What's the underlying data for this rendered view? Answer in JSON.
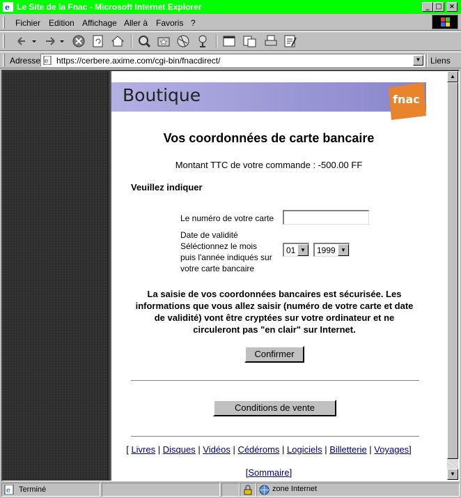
{
  "window": {
    "title": "Le Site de la Fnac - Microsoft Internet Explorer",
    "controls": {
      "minimize": "_",
      "maximize": "□",
      "close": "×"
    }
  },
  "menu": {
    "items": [
      {
        "label": "Fichier"
      },
      {
        "label": "Edition"
      },
      {
        "label": "Affichage"
      },
      {
        "label": "Aller à"
      },
      {
        "label": "Favoris"
      },
      {
        "label": "?"
      }
    ]
  },
  "toolbar": {
    "buttons": [
      "back-icon",
      "forward-icon",
      "stop-icon",
      "refresh-icon",
      "home-icon",
      "search-icon",
      "favorites-icon",
      "history-icon",
      "channels-icon",
      "fullscreen-icon",
      "mail-icon",
      "print-icon",
      "edit-icon"
    ]
  },
  "address": {
    "label": "Adresse",
    "url": "https://cerbere.axime.com/cgi-bin/fnacdirect/",
    "links_label": "Liens"
  },
  "page": {
    "banner_title": "Boutique",
    "logo_text": "fnac",
    "heading": "Vos coordonnées de carte bancaire",
    "amount_text": "Montant TTC de votre commande : -500.00 FF",
    "indicate_label": "Veuillez indiquer",
    "card_number_label": "Le numéro de votre carte",
    "card_number_value": "",
    "validity_lines": [
      "Date de validité",
      "Séléctionnez le mois",
      "puis l'année indiqués sur",
      "votre carte bancaire"
    ],
    "month_value": "01",
    "year_value": "1999",
    "secure_lines": [
      "La saisie de vos coordonnées bancaires est sécurisée. Les",
      "informations que vous allez saisir (numéro de votre carte et date",
      "de validité) vont être cryptées sur votre ordinateur et ne",
      "circuleront pas \"en clair\" sur Internet."
    ],
    "confirm_label": "Confirmer",
    "conditions_label": "Conditions de vente",
    "nav_links": [
      "Livres",
      "Disques",
      "Vidéos",
      "Cédéroms",
      "Logiciels",
      "Billetterie",
      "Voyages"
    ],
    "sommaire_label": "Sommaire"
  },
  "status": {
    "text": "Terminé",
    "zone": "zone Internet"
  },
  "colors": {
    "titlebar": "#00ff00",
    "chrome": "#c0c0c0",
    "banner": "#a9a5dd",
    "logo": "#e8842c",
    "link": "#000080"
  }
}
